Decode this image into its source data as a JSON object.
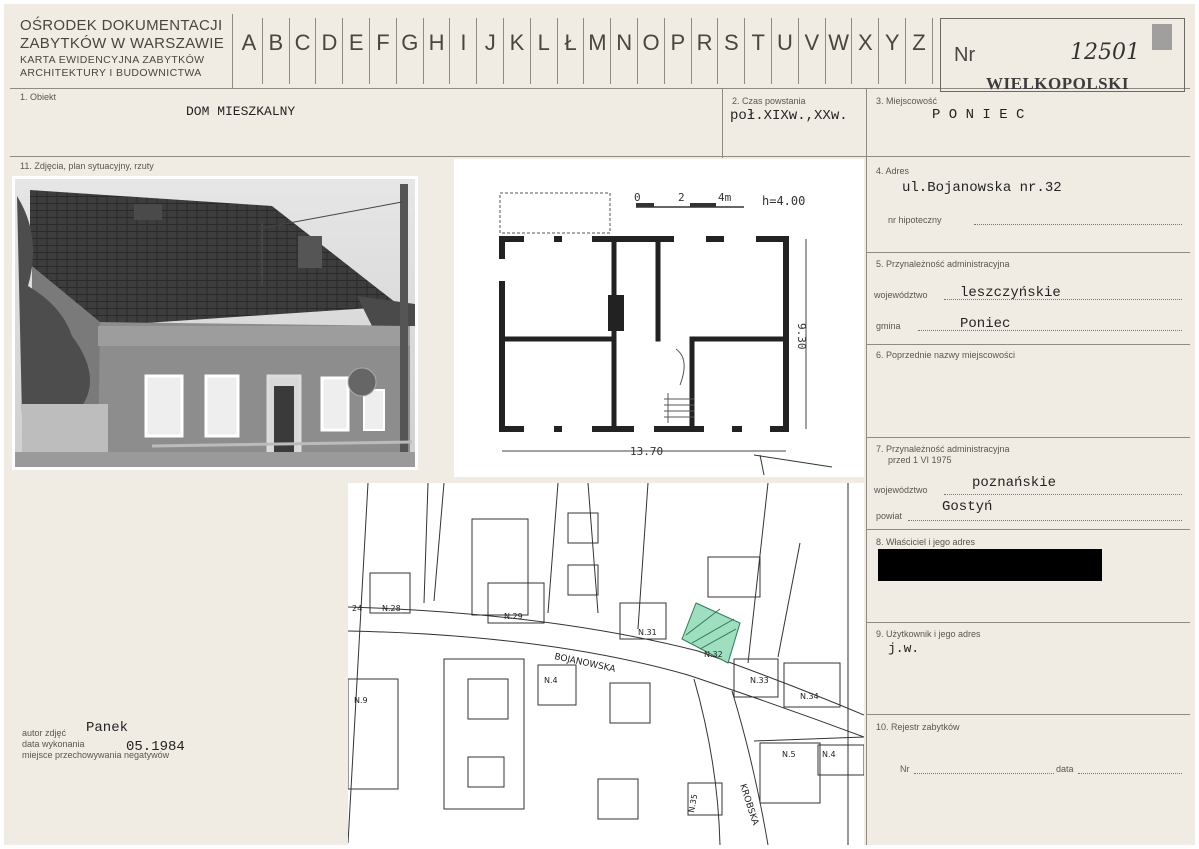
{
  "header": {
    "institution": [
      "OŚRODEK DOKUMENTACJI",
      "ZABYTKÓW W WARSZAWIE"
    ],
    "card_type": [
      "KARTA EWIDENCYJNA ZABYTKÓW",
      "ARCHITEKTURY I BUDOWNICTWA"
    ],
    "alphabet": [
      "A",
      "B",
      "C",
      "D",
      "E",
      "F",
      "G",
      "H",
      "I",
      "J",
      "K",
      "L",
      "Ł",
      "M",
      "N",
      "O",
      "P",
      "R",
      "S",
      "T",
      "U",
      "V",
      "W",
      "X",
      "Y",
      "Z"
    ],
    "nr_label": "Nr",
    "nr_value": "12501",
    "stamp": "WIELKOPOLSKIE",
    "stamp_crop": "WIELKOPOLSKI"
  },
  "fields": {
    "obiekt_label": "1. Obiekt",
    "obiekt_value": "DOM MIESZKALNY",
    "czas_label": "2. Czas powstania",
    "czas_value": "poł.XIXw.,XXw.",
    "miejscowosc_label": "3. Miejscowość",
    "miejscowosc_value": "P O N I E C",
    "zdjecia_label": "11. Zdjęcia, plan sytuacyjny, rzuty",
    "adres_label": "4. Adres",
    "adres_value": "ul.Bojanowska nr.32",
    "hipoteczny_label": "nr hipoteczny",
    "przynaleznosc_label": "5. Przynależność administracyjna",
    "wojewodztwo_label": "województwo",
    "wojewodztwo_value": "leszczyńskie",
    "gmina_label": "gmina",
    "gmina_value": "Poniec",
    "poprzednie_label": "6. Poprzednie nazwy miejscowości",
    "przynaleznosc_przed_label": "7. Przynależność administracyjna",
    "przynaleznosc_przed_date": "przed 1 VI 1975",
    "wojewodztwo2_label": "województwo",
    "wojewodztwo2_value": "poznańskie",
    "powiat_label": "powiat",
    "powiat_value": "Gostyń",
    "wlasciciel_label": "8. Właściciel i jego adres",
    "uzytkownik_label": "9. Użytkownik i jego adres",
    "uzytkownik_value": "j.w.",
    "rejestr_label": "10. Rejestr zabytków",
    "rejestr_nr_label": "Nr",
    "rejestr_data_label": "data"
  },
  "photo_meta": {
    "autor_label": "autor zdjęć",
    "autor_value": "Panek",
    "data_label": "data wykonania",
    "data_value": "05.1984",
    "miejsce_label": "miejsce przechowywania negatywów"
  },
  "floorplan": {
    "scale_0": "0",
    "scale_2": "2",
    "scale_4": "4m",
    "height": "h=4.00",
    "width_dim": "13.70",
    "depth_dim": "9.30"
  },
  "siteplan": {
    "street_main": "BOJANOWSKA",
    "street_side": "KROBSKA",
    "parcels": [
      "24",
      "N.28",
      "N.29",
      "N.31",
      "N.32",
      "N.33",
      "N.34",
      "N.9",
      "N.4",
      "N.5",
      "N.4",
      "N.35"
    ]
  }
}
